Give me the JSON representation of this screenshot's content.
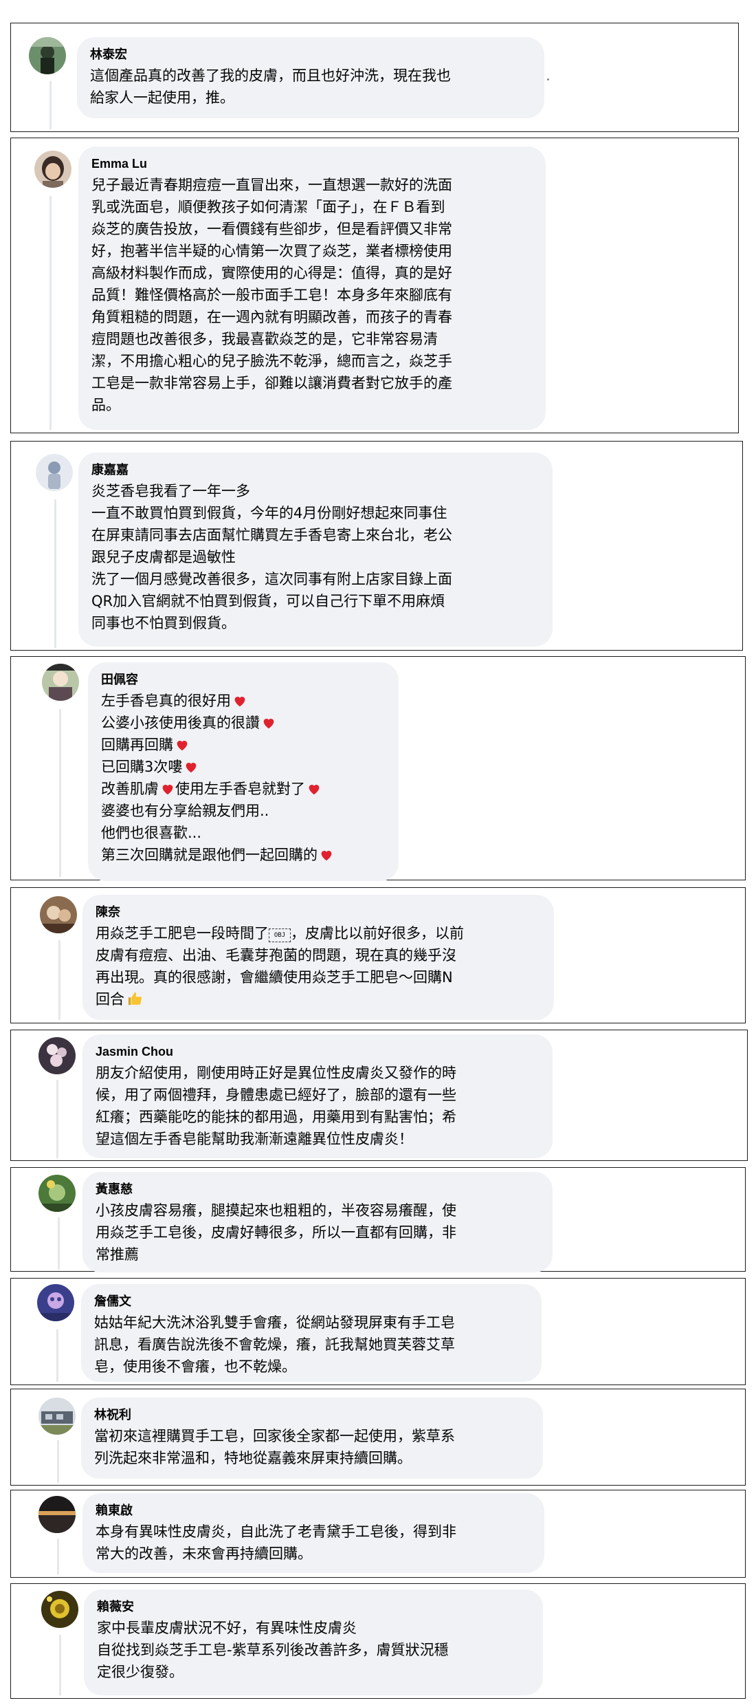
{
  "comments": [
    {
      "name": "林泰宏",
      "lines": [
        "這個產品真的改善了我的皮膚，而且也好沖洗，現在我也",
        "給家人一起使用，推。"
      ]
    },
    {
      "name": "Emma Lu",
      "lines": [
        "兒子最近青春期痘痘一直冒出來，一直想選一款好的洗面",
        "乳或洗面皂，順便教孩子如何清潔「面子」，在ＦＢ看到",
        "焱芝的廣告投放，一看價錢有些卻步，但是看評價又非常",
        "好，抱著半信半疑的心情第一次買了焱芝，業者標榜使用",
        "高級材料製作而成，實際使用的心得是：值得，真的是好",
        "品質！難怪價格高於一般市面手工皂！本身多年來腳底有",
        "角質粗糙的問題，在一週內就有明顯改善，而孩子的青春",
        "痘問題也改善很多，我最喜歡焱芝的是，它非常容易清",
        "潔，不用擔心粗心的兒子臉洗不乾淨，總而言之，焱芝手",
        "工皂是一款非常容易上手，卻難以讓消費者對它放手的產",
        "品。"
      ]
    },
    {
      "name": "康嘉嘉",
      "lines": [
        "炎芝香皂我看了一年一多",
        "一直不敢買怕買到假貨，今年的4月份剛好想起來同事住",
        "在屏東請同事去店面幫忙購買左手香皂寄上來台北，老公",
        "跟兒子皮膚都是過敏性",
        "洗了一個月感覺改善很多，這次同事有附上店家目錄上面",
        "QR加入官網就不怕買到假貨，可以自己行下單不用麻煩",
        "同事也不怕買到假貨。"
      ]
    },
    {
      "name": "田佩容",
      "lines": [
        "左手香皂真的很好用",
        "公婆小孩使用後真的很讚",
        "回購再回購",
        "已回購3次嘍",
        "改善肌膚",
        "婆婆也有分享給親友們用..",
        "他們也很喜歡...",
        "第三次回購就是跟他們一起回購的"
      ],
      "line5_tail": "使用左手香皂就對了"
    },
    {
      "name": "陳奈",
      "lines": [
        "用焱芝手工肥皂一段時間了",
        "皮膚有痘痘、出油、毛囊芽孢菌的問題，現在真的幾乎沒",
        "再出現。真的很感謝，會繼續使用焱芝手工肥皂～回購N",
        "回合"
      ],
      "line1_tail": "，皮膚比以前好很多，以前",
      "obj_glyph": "OBJ"
    },
    {
      "name": "Jasmin Chou",
      "lines": [
        "朋友介紹使用，剛使用時正好是異位性皮膚炎又發作的時",
        "候，用了兩個禮拜，身體患處已經好了，臉部的還有一些",
        "紅癢；西藥能吃的能抹的都用過，用藥用到有點害怕；希",
        "望這個左手香皂能幫助我漸漸遠離異位性皮膚炎！"
      ]
    },
    {
      "name": "黃惠慈",
      "lines": [
        "小孩皮膚容易癢，腿摸起來也粗粗的，半夜容易癢醒，使",
        "用焱芝手工皂後，皮膚好轉很多，所以一直都有回購，非",
        "常推薦"
      ]
    },
    {
      "name": "詹儒文",
      "lines": [
        "姑姑年紀大洗沐浴乳雙手會癢，從網站發現屏東有手工皂",
        "訊息，看廣告說洗後不會乾燥，癢，託我幫她買芙蓉艾草",
        "皂，使用後不會癢，也不乾燥。"
      ]
    },
    {
      "name": "林祝利",
      "lines": [
        "當初來這裡購買手工皂，回家後全家都一起使用，紫草系",
        "列洗起來非常溫和，特地從嘉義來屏東持續回購。"
      ]
    },
    {
      "name": "賴東啟",
      "lines": [
        "本身有異味性皮膚炎，自此洗了老青黛手工皂後，得到非",
        "常大的改善，未來會再持續回購。"
      ]
    },
    {
      "name": "賴薇安",
      "lines": [
        "家中長輩皮膚狀況不好，有異味性皮膚炎",
        "自從找到焱芝手工皂-紫草系列後改善許多，膚質狀況穩",
        "定很少復發。"
      ]
    }
  ],
  "icons": {
    "heart": "red-heart-emoji",
    "thumb": "thumbs-up-emoji",
    "obj": "object-replacement-character"
  },
  "colors": {
    "bubble": "#f0f2f5",
    "heart": "#e0222f",
    "thumb": "#f7c32e",
    "border": "#1c1c1c"
  }
}
